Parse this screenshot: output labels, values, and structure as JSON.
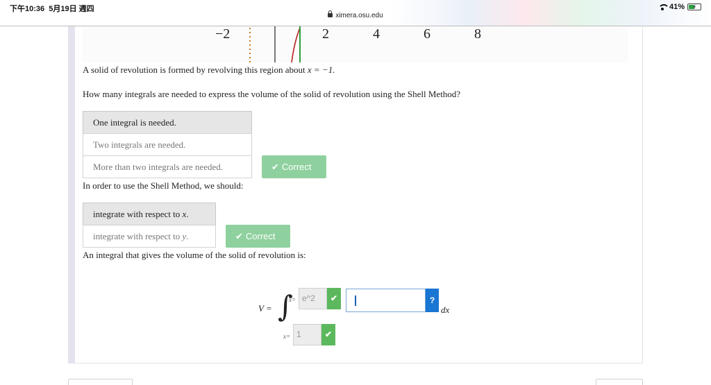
{
  "status_bar": {
    "time": "下午10:36",
    "date": "5月19日 週四",
    "url": "ximera.osu.edu",
    "battery": "41%"
  },
  "graph": {
    "ticks": [
      "−2",
      "2",
      "4",
      "6",
      "8"
    ]
  },
  "problem": {
    "statement_pre": "A solid of revolution is formed by revolving this region about ",
    "statement_math": "x = −1.",
    "q1": "How many integrals are needed to express the volume of the solid of revolution using the Shell Method?",
    "q1_choices": [
      "One integral is needed.",
      "Two integrals are needed.",
      "More than two integrals are needed."
    ],
    "q1_selected_index": 0,
    "q2": "In order to use the Shell Method, we should:",
    "q2_choices": [
      {
        "pre": "integrate with respect to ",
        "var": "x",
        "post": "."
      },
      {
        "pre": "integrate with respect to ",
        "var": "y",
        "post": "."
      }
    ],
    "q2_selected_index": 0,
    "q3": "An integral that gives the volume of the solid of revolution is:",
    "feedback": "Correct"
  },
  "integral": {
    "lhs": "V =",
    "upper_label": "x=",
    "upper_value": "e^2",
    "lower_label": "x=",
    "lower_value": "1",
    "integrand_value": "",
    "help_label": "?",
    "differential": "dx"
  },
  "colors": {
    "correct_bg": "#8fd19e",
    "check_green": "#5cb85c",
    "help_blue": "#1976d2",
    "selected_bg": "#e6e6e6"
  }
}
